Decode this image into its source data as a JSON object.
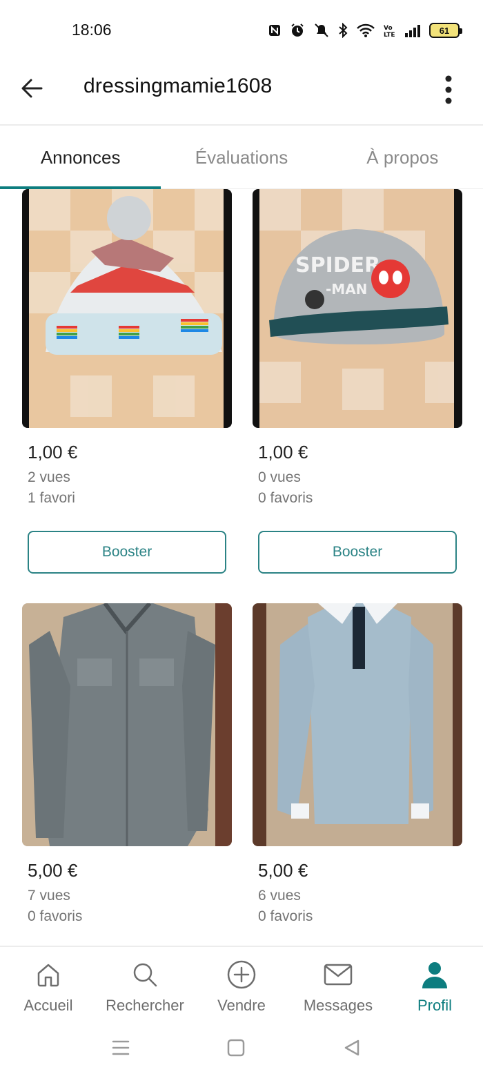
{
  "status_bar": {
    "time": "18:06",
    "icons": [
      "nfc-icon",
      "alarm-icon",
      "mute-icon",
      "bluetooth-icon",
      "wifi-icon",
      "volte-icon",
      "signal-icon"
    ],
    "battery": "61"
  },
  "header": {
    "username": "dressingmamie1608",
    "back_icon": "arrow-left-icon",
    "more_icon": "more-vertical-icon"
  },
  "tabs": [
    {
      "label": "Annonces",
      "active": true
    },
    {
      "label": "Évaluations",
      "active": false
    },
    {
      "label": "À propos",
      "active": false
    }
  ],
  "listings": [
    {
      "price": "1,00 €",
      "views": "2 vues",
      "favorites": "1 favori",
      "boost_label": "Booster",
      "image": "knit-beanie-rainbow-pompom"
    },
    {
      "price": "1,00 €",
      "views": "0 vues",
      "favorites": "0 favoris",
      "boost_label": "Booster",
      "image": "spider-man-grey-beanie"
    },
    {
      "price": "5,00 €",
      "views": "7 vues",
      "favorites": "0 favoris",
      "image": "grey-denim-shirt"
    },
    {
      "price": "5,00 €",
      "views": "6 vues",
      "favorites": "0 favoris",
      "image": "light-blue-dress-shirt"
    }
  ],
  "bottom_nav": [
    {
      "label": "Accueil",
      "icon": "home-icon",
      "active": false
    },
    {
      "label": "Rechercher",
      "icon": "search-icon",
      "active": false
    },
    {
      "label": "Vendre",
      "icon": "plus-circle-icon",
      "active": false
    },
    {
      "label": "Messages",
      "icon": "mail-icon",
      "active": false
    },
    {
      "label": "Profil",
      "icon": "profile-icon",
      "active": true
    }
  ],
  "colors": {
    "accent": "#0d7d7f",
    "button_border": "#2b8385",
    "muted_text": "#757575"
  }
}
